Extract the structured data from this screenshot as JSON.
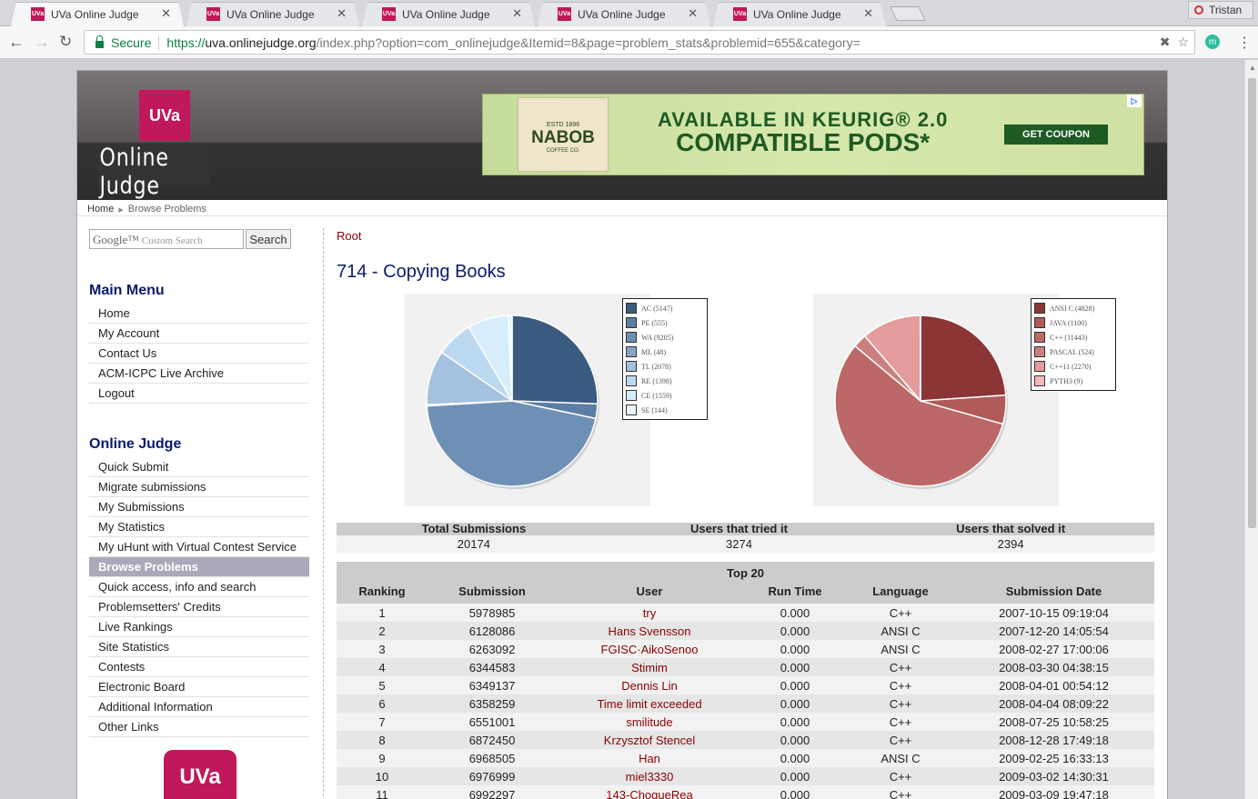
{
  "browser": {
    "tabs": [
      {
        "title": "UVa Online Judge",
        "fav": "UVa",
        "active": true
      },
      {
        "title": "UVa Online Judge",
        "fav": "UVa",
        "active": false
      },
      {
        "title": "UVa Online Judge",
        "fav": "UVa",
        "active": false
      },
      {
        "title": "UVa Online Judge",
        "fav": "UVa",
        "active": false
      },
      {
        "title": "UVa Online Judge",
        "fav": "UVa",
        "active": false
      }
    ],
    "profile_name": "Tristan",
    "secure_label": "Secure",
    "url_proto": "https://",
    "url_host": "uva.onlinejudge.org",
    "url_path": "/index.php?option=com_onlinejudge&Itemid=8&page=problem_stats&problemid=655&category=",
    "ext_letter": "m"
  },
  "header": {
    "logo_box": "UVa",
    "logo_text": "Online Judge"
  },
  "ad": {
    "badge_top": "ESTD 1896",
    "badge_brand": "NABOB",
    "badge_sub": "COFFEE CO.",
    "line1": "AVAILABLE IN KEURIG® 2.0",
    "line2": "COMPATIBLE PODS*",
    "cta": "GET COUPON"
  },
  "breadcrumb": {
    "home": "Home",
    "current": "Browse Problems"
  },
  "search": {
    "placeholder_brand": "Google™",
    "placeholder_text": "Custom Search",
    "button": "Search"
  },
  "main_menu": {
    "title": "Main Menu",
    "items": [
      "Home",
      "My Account",
      "Contact Us",
      "ACM-ICPC Live Archive",
      "Logout"
    ]
  },
  "online_judge_menu": {
    "title": "Online Judge",
    "items": [
      "Quick Submit",
      "Migrate submissions",
      "My Submissions",
      "My Statistics",
      "My uHunt with Virtual Contest Service",
      "Browse Problems",
      "Quick access, info and search",
      "Problemsetters' Credits",
      "Live Rankings",
      "Site Statistics",
      "Contests",
      "Electronic Board",
      "Additional Information",
      "Other Links"
    ],
    "active_index": 5
  },
  "side_logo": "UVa",
  "root_link": "Root",
  "problem_title": "714 - Copying Books",
  "chart_data": [
    {
      "type": "pie",
      "categories": [
        "AC",
        "PE",
        "WA",
        "ML",
        "TL",
        "RE",
        "CE",
        "SE"
      ],
      "values": [
        5147,
        555,
        9205,
        48,
        2078,
        1398,
        1559,
        144
      ],
      "colors": [
        "#3a5c80",
        "#5b7ea3",
        "#6e90b5",
        "#86a5c6",
        "#a4c1df",
        "#bcd9f2",
        "#d6eefb",
        "#eaf7fd"
      ]
    },
    {
      "type": "pie",
      "categories": [
        "ANSI C",
        "JAVA",
        "C++",
        "PASCAL",
        "C++11",
        "PYTH3"
      ],
      "values": [
        4828,
        1100,
        11443,
        524,
        2270,
        9
      ],
      "colors": [
        "#8b3535",
        "#b05a5a",
        "#bd6868",
        "#cc7f7f",
        "#e49b9b",
        "#f5b8b8"
      ]
    }
  ],
  "stats": {
    "headers": [
      "Total Submissions",
      "Users that tried it",
      "Users that solved it"
    ],
    "values": [
      "20174",
      "3274",
      "2394"
    ]
  },
  "top20": {
    "title": "Top 20",
    "columns": [
      "Ranking",
      "Submission",
      "User",
      "Run Time",
      "Language",
      "Submission Date"
    ],
    "rows": [
      [
        "1",
        "5978985",
        "try",
        "0.000",
        "C++",
        "2007-10-15 09:19:04"
      ],
      [
        "2",
        "6128086",
        "Hans Svensson",
        "0.000",
        "ANSI C",
        "2007-12-20 14:05:54"
      ],
      [
        "3",
        "6263092",
        "FGISC·AikoSenoo",
        "0.000",
        "ANSI C",
        "2008-02-27 17:00:06"
      ],
      [
        "4",
        "6344583",
        "Stimim",
        "0.000",
        "C++",
        "2008-03-30 04:38:15"
      ],
      [
        "5",
        "6349137",
        "Dennis Lin",
        "0.000",
        "C++",
        "2008-04-01 00:54:12"
      ],
      [
        "6",
        "6358259",
        "Time limit exceeded",
        "0.000",
        "C++",
        "2008-04-04 08:09:22"
      ],
      [
        "7",
        "6551001",
        "smilitude",
        "0.000",
        "C++",
        "2008-07-25 10:58:25"
      ],
      [
        "8",
        "6872450",
        "Krzysztof Stencel",
        "0.000",
        "C++",
        "2008-12-28 17:49:18"
      ],
      [
        "9",
        "6968505",
        "Han",
        "0.000",
        "ANSI C",
        "2009-02-25 16:33:13"
      ],
      [
        "10",
        "6976999",
        "miel3330",
        "0.000",
        "C++",
        "2009-03-02 14:30:31"
      ],
      [
        "11",
        "6992297",
        "143-ChoqueRea",
        "0.000",
        "C++",
        "2009-03-09 19:47:18"
      ]
    ]
  }
}
